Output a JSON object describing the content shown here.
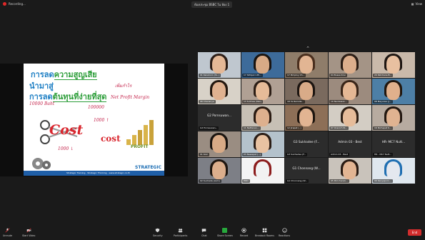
{
  "topbar": {
    "recording_label": "Recording...",
    "meeting_title": "ห้องประชุม BSBC ใน ห้อง 1",
    "view_label": "View"
  },
  "slide": {
    "title1_prefix": "การลด",
    "title1_highlight": "ความสูญเสีย",
    "title2": "นำมาสู่",
    "title3_prefix": "การลด",
    "title3_highlight": "ต้นทุนที่ง่ายที่สุด",
    "note_a": "10000 Baht",
    "note_b": "100000",
    "note_c": "เพิ่มกำไร",
    "note_d": "Net Profit Margin",
    "note_e": "1000 ↑",
    "note_f": "1000 ↓",
    "cost_big": "Cost",
    "cost_small": "cost",
    "profit": "PROFIT",
    "logo": "STRATEGIC",
    "footer": "Strategic Training · Strategic Thinking · www.strategic.co.th"
  },
  "gallery": {
    "tiles": [
      {
        "label": "01 Kanokorn (Yu..)",
        "skin": "#e4b896",
        "hair": "#2b1d16",
        "bg": "#bfc7cf",
        "type": "cam"
      },
      {
        "label": "17 Sittiporn Ph...",
        "skin": "#d8aa86",
        "hair": "#1a1410",
        "bg": "#3d6b9a",
        "type": "cam"
      },
      {
        "label": "17 Pimploy Ch...",
        "skin": "#e2b593",
        "hair": "#4a2f1e",
        "bg": "#8f7d6a",
        "type": "cam"
      },
      {
        "label": "04 Bussa Krai",
        "skin": "#dcae8c",
        "hair": "#2a1c14",
        "bg": "#a49486",
        "type": "cam"
      },
      {
        "label": "20 Patchara-M...",
        "skin": "#e8c0a0",
        "hair": "#1e1612",
        "bg": "#c9b9aa",
        "type": "cam"
      },
      {
        "label": "06 Chananya",
        "skin": "#e0b290",
        "hair": "#24180f",
        "bg": "#d8d2c8",
        "type": "cam"
      },
      {
        "label": "13 Sutinee (Nan)",
        "skin": "#e6bb98",
        "hair": "#2c1e16",
        "bg": "#b0a094",
        "type": "cam"
      },
      {
        "label": "18 Ya Ramida...",
        "skin": "#d9ab88",
        "hair": "#1c1511",
        "bg": "#7a6a5e",
        "type": "cam"
      },
      {
        "label": "19 Nantawan...",
        "skin": "#e4b794",
        "hair": "#3a2619",
        "bg": "#9c8b7e",
        "type": "cam"
      },
      {
        "label": "08 Mayuree (J...",
        "skin": "#e0b08c",
        "hair": "#21170f",
        "bg": "#4d7fa6",
        "type": "cam"
      },
      {
        "label": "G2 Pornsuwan...",
        "name": "G2 Pornsuwan...",
        "type": "name"
      },
      {
        "label": "11 Nattanan...",
        "skin": "#ddb08e",
        "hair": "#2a1b12",
        "bg": "#c7c0b5",
        "type": "cam"
      },
      {
        "label": "12 Jirapat (..)",
        "skin": "#e2b492",
        "hair": "#1d150f",
        "bg": "#8d6f57",
        "type": "cam"
      },
      {
        "label": "07 Oranich Ri...",
        "skin": "#e6bc9a",
        "hair": "#2e2016",
        "bg": "#d3cdc4",
        "type": "cam"
      },
      {
        "label": "16 Nichapat K...",
        "skin": "#e0b391",
        "hair": "#231811",
        "bg": "#b7aba0",
        "type": "cam"
      },
      {
        "label": "01 Kom",
        "skin": "#d8aa86",
        "hair": "#1a1410",
        "bg": "#9a8d82",
        "type": "cam"
      },
      {
        "label": "03 Nawapat (...)",
        "skin": "#e8c2a2",
        "hair": "#2b1d16",
        "bg": "#b4c2cc",
        "type": "cam"
      },
      {
        "label": "G3 Sukhadee (F...",
        "name": "G3 Sukhadee (F...",
        "type": "name"
      },
      {
        "label": "Admin 03 - Best",
        "name": "Admin 03 - Best",
        "type": "name"
      },
      {
        "label": "HR - MC7 Nutt...",
        "name": "HR- MC7 Nutt...",
        "type": "name"
      },
      {
        "label": "02 Suchada (Aom)",
        "skin": "#dcae8c",
        "hair": "#1f1610",
        "bg": "#7d7f86",
        "type": "cam"
      },
      {
        "label": "HRD",
        "skin": "#f2f2f2",
        "hair": "#8c1c1c",
        "bg": "#f4f4f4",
        "type": "cam"
      },
      {
        "label": "G1 Chonnang (W...",
        "name": "G1 Chonnang (W...",
        "type": "name"
      },
      {
        "label": "05 Pimchanok...",
        "skin": "#e2b593",
        "hair": "#2a1c14",
        "bg": "#c9c3bb",
        "type": "cam"
      },
      {
        "label": "09 Kanyaporn...",
        "skin": "#e4e8ef",
        "hair": "#1f6fb2",
        "bg": "#dfe7ee",
        "type": "cam"
      }
    ]
  },
  "toolbar": {
    "unmute": "Unmute",
    "start_video": "Start Video",
    "security": "Security",
    "participants": "Participants",
    "chat": "Chat",
    "share_screen": "Share Screen",
    "record": "Record",
    "breakout_rooms": "Breakout Rooms",
    "reactions": "Reactions",
    "end": "End"
  },
  "colors": {
    "accent_green": "#27a83c",
    "end_red": "#d22d2d",
    "slide_blue": "#1e7fc4",
    "slide_green": "#2d9e3a"
  }
}
